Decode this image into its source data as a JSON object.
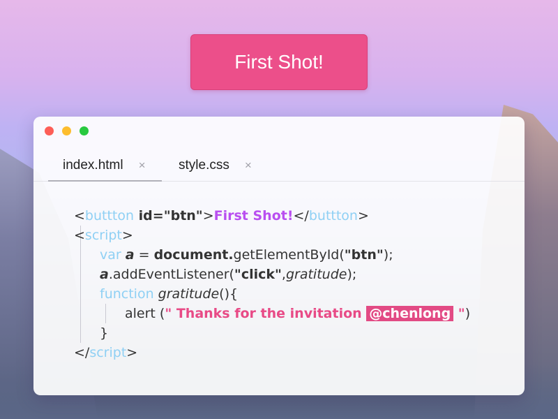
{
  "button": {
    "label": "First Shot!"
  },
  "tabs": [
    {
      "label": "index.html",
      "close": "×",
      "active": true
    },
    {
      "label": "style.css",
      "close": "×",
      "active": false
    }
  ],
  "code": {
    "l1": {
      "lt": "<",
      "tag": "buttton",
      "attr": " id=\"btn\"",
      "gt": ">",
      "text": "First Shot!",
      "close_lt": "</",
      "close_tag": "buttton",
      "close_gt": ">"
    },
    "l2": {
      "lt": "<",
      "tag": "script",
      "gt": ">"
    },
    "l3": {
      "kw": "var",
      "space": " ",
      "var": "a",
      "eq": " = ",
      "obj": "document.",
      "method": "getElementById(",
      "arg": "\"btn\"",
      "end": ");"
    },
    "l4": {
      "var": "a",
      "method": ".addEventListener(",
      "arg": "\"click\"",
      "comma": ",",
      "fn": "gratitude",
      "end": ");"
    },
    "l5": {
      "kw": "function",
      "space": " ",
      "fn": "gratitude",
      "end": "(){"
    },
    "l6": {
      "call": "alert (",
      "str": "\" Thanks for the invitation ",
      "highlight": "@chenlong",
      "str_end": " \"",
      "end": ")"
    },
    "l7": {
      "brace": "}"
    },
    "l8": {
      "lt": "</",
      "tag": "script",
      "gt": ">"
    }
  },
  "colors": {
    "accent": "#ec4f8a",
    "tag": "#8fd0f4",
    "purple": "#b94ff0",
    "string": "#e84a86"
  }
}
